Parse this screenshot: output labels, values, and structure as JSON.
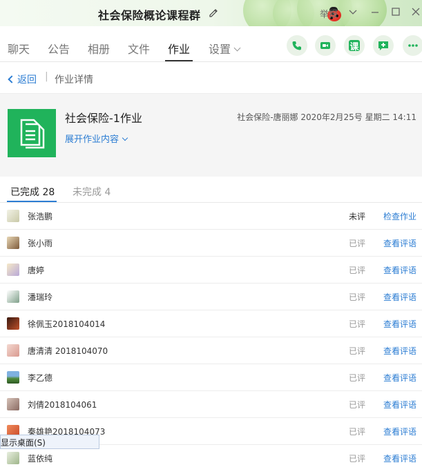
{
  "window": {
    "title": "社会保险概论课程群",
    "report_label": "举报"
  },
  "nav": {
    "tabs": [
      {
        "label": "聊天"
      },
      {
        "label": "公告"
      },
      {
        "label": "相册"
      },
      {
        "label": "文件"
      },
      {
        "label": "作业"
      },
      {
        "label": "设置"
      }
    ],
    "active_tab": "作业",
    "class_button_label": "课",
    "accent_color": "#20b35b"
  },
  "breadcrumb": {
    "back_label": "返回",
    "current": "作业详情"
  },
  "homework": {
    "name": "社会保险-1作业",
    "meta": "社会保险-唐丽娜 2020年2月25号 星期二 14:11",
    "expand_label": "展开作业内容"
  },
  "completion_tabs": {
    "completed": "已完成 28",
    "incomplete": "未完成 4"
  },
  "students": [
    {
      "name": "张浩鹏",
      "status": "未评",
      "action": "检查作业"
    },
    {
      "name": "张小雨",
      "status": "已评",
      "action": "查看评语"
    },
    {
      "name": "唐婷",
      "status": "已评",
      "action": "查看评语"
    },
    {
      "name": "潘瑞玲",
      "status": "已评",
      "action": "查看评语"
    },
    {
      "name": "徐佩玉2018104014",
      "status": "已评",
      "action": "查看评语"
    },
    {
      "name": "唐清清 2018104070",
      "status": "已评",
      "action": "查看评语"
    },
    {
      "name": "李乙德",
      "status": "已评",
      "action": "查看评语"
    },
    {
      "name": "刘倩2018104061",
      "status": "已评",
      "action": "查看评语"
    },
    {
      "name": "秦雄艳2018104073",
      "status": "已评",
      "action": "查看评语"
    },
    {
      "name": "蓝依纯",
      "status": "已评",
      "action": "查看评语"
    }
  ],
  "tooltip": {
    "text": "显示桌面(S)"
  },
  "colors": {
    "link": "#2c7dd3",
    "homework_icon": "#20b35b"
  }
}
